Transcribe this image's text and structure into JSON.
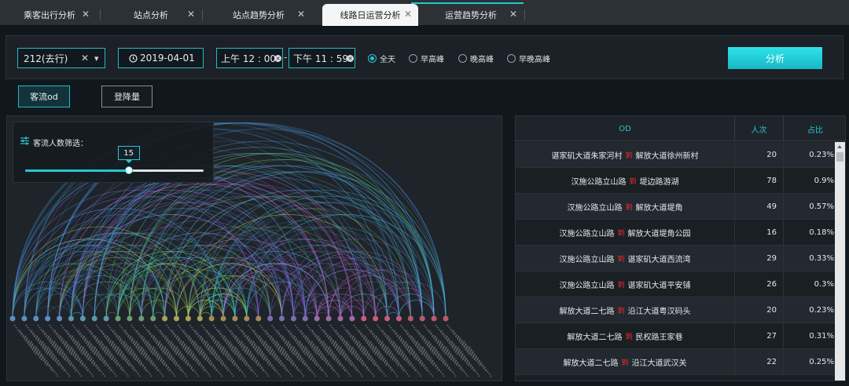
{
  "tabs": [
    {
      "label": "乘客出行分析",
      "close": "✕"
    },
    {
      "label": "站点分析",
      "close": "✕"
    },
    {
      "label": "站点趋势分析",
      "close": "✕"
    },
    {
      "label": "线路日运营分析",
      "close": "✕"
    },
    {
      "label": "运营趋势分析",
      "close": "✕"
    }
  ],
  "toolbar": {
    "route_value": "212(去行)",
    "date_value": "2019-04-01",
    "time_start": "上午 12 : 00",
    "time_sep": "-",
    "time_end": "下午 11 : 59",
    "period_options": [
      "全天",
      "早高峰",
      "晚高峰",
      "早晚高峰"
    ],
    "period_selected": "全天",
    "analyze_label": "分析"
  },
  "view_buttons": {
    "od_label": "客流od",
    "board_label": "登降量"
  },
  "filter": {
    "title": "客流人数筛选：",
    "value": "15",
    "fraction": 0.58
  },
  "table": {
    "headers": {
      "od": "OD",
      "count": "人次",
      "pct": "占比"
    },
    "to_label": "到",
    "rows": [
      {
        "from": "谌家矶大道朱家河村",
        "to": "解放大道徐州新村",
        "count": "20",
        "pct": "0.23%"
      },
      {
        "from": "汉施公路立山路",
        "to": "堤边路游湖",
        "count": "78",
        "pct": "0.9%"
      },
      {
        "from": "汉施公路立山路",
        "to": "解放大道堤角",
        "count": "49",
        "pct": "0.57%"
      },
      {
        "from": "汉施公路立山路",
        "to": "解放大道堤角公园",
        "count": "16",
        "pct": "0.18%"
      },
      {
        "from": "汉施公路立山路",
        "to": "谌家矶大道西流湾",
        "count": "29",
        "pct": "0.33%"
      },
      {
        "from": "汉施公路立山路",
        "to": "谌家矶大道平安铺",
        "count": "26",
        "pct": "0.3%"
      },
      {
        "from": "解放大道二七路",
        "to": "沿江大道粤汉码头",
        "count": "20",
        "pct": "0.23%"
      },
      {
        "from": "解放大道二七路",
        "to": "民权路王家巷",
        "count": "27",
        "pct": "0.31%"
      },
      {
        "from": "解放大道二七路",
        "to": "沿江大道武汉关",
        "count": "22",
        "pct": "0.25%"
      }
    ]
  },
  "colors": {
    "accent": "#27c6cf",
    "to_text": "#ff2a2a"
  },
  "icons": {
    "route_clear": "✕",
    "dropdown": "▾",
    "clock": "clock-icon",
    "filter": "filter-icon"
  }
}
